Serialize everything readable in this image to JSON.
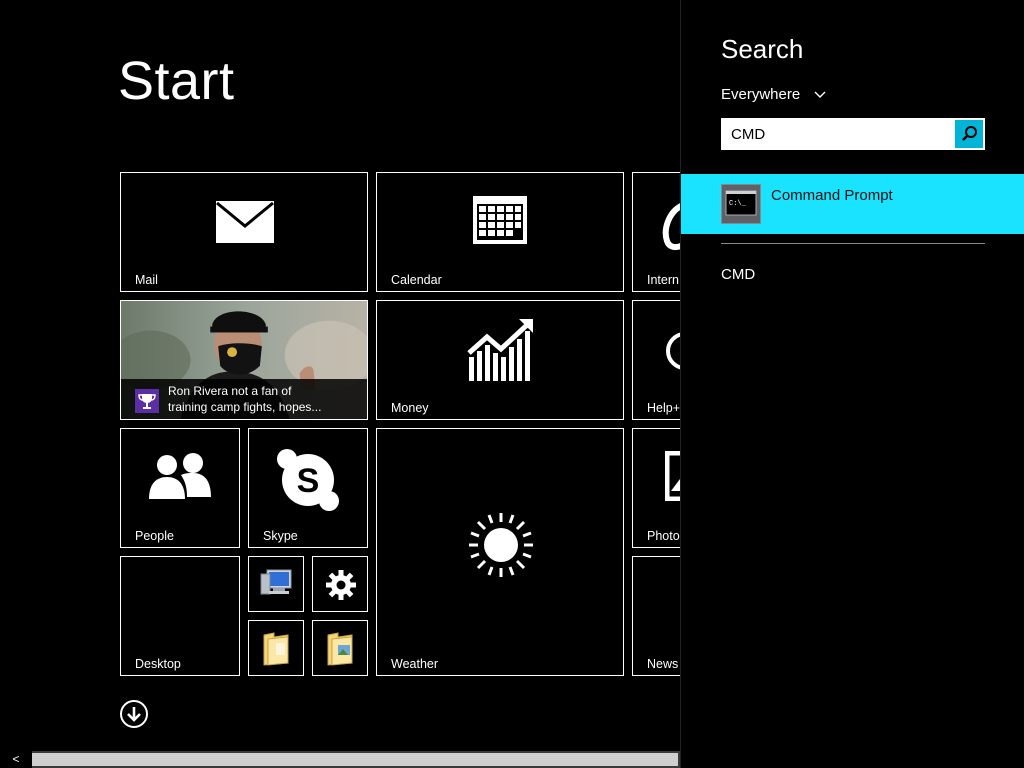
{
  "start": {
    "title": "Start",
    "tiles": {
      "mail": "Mail",
      "calendar": "Calendar",
      "internet": "Intern",
      "news_headline_line1": "Ron Rivera not a fan of",
      "news_headline_line2": "training camp fights, hopes...",
      "money": "Money",
      "help": "Help+",
      "people": "People",
      "skype": "Skype",
      "weather": "Weather",
      "photos": "Photo",
      "desktop": "Desktop",
      "news": "News"
    },
    "small_tiles_icons": [
      "computer-icon",
      "gear-icon",
      "folder-icon",
      "folder-pictures-icon"
    ],
    "scroll_left_glyph": "<"
  },
  "search_charm": {
    "title": "Search",
    "scope": "Everywhere",
    "query": "CMD",
    "results": [
      {
        "label": "Command Prompt",
        "icon": "command-prompt-icon",
        "highlighted": true
      }
    ],
    "suggestions": [
      "CMD"
    ]
  },
  "colors": {
    "background": "#000000",
    "highlight": "#1ae3ff",
    "search_button": "#00b4d8",
    "news_badge": "#5b2fa3"
  }
}
